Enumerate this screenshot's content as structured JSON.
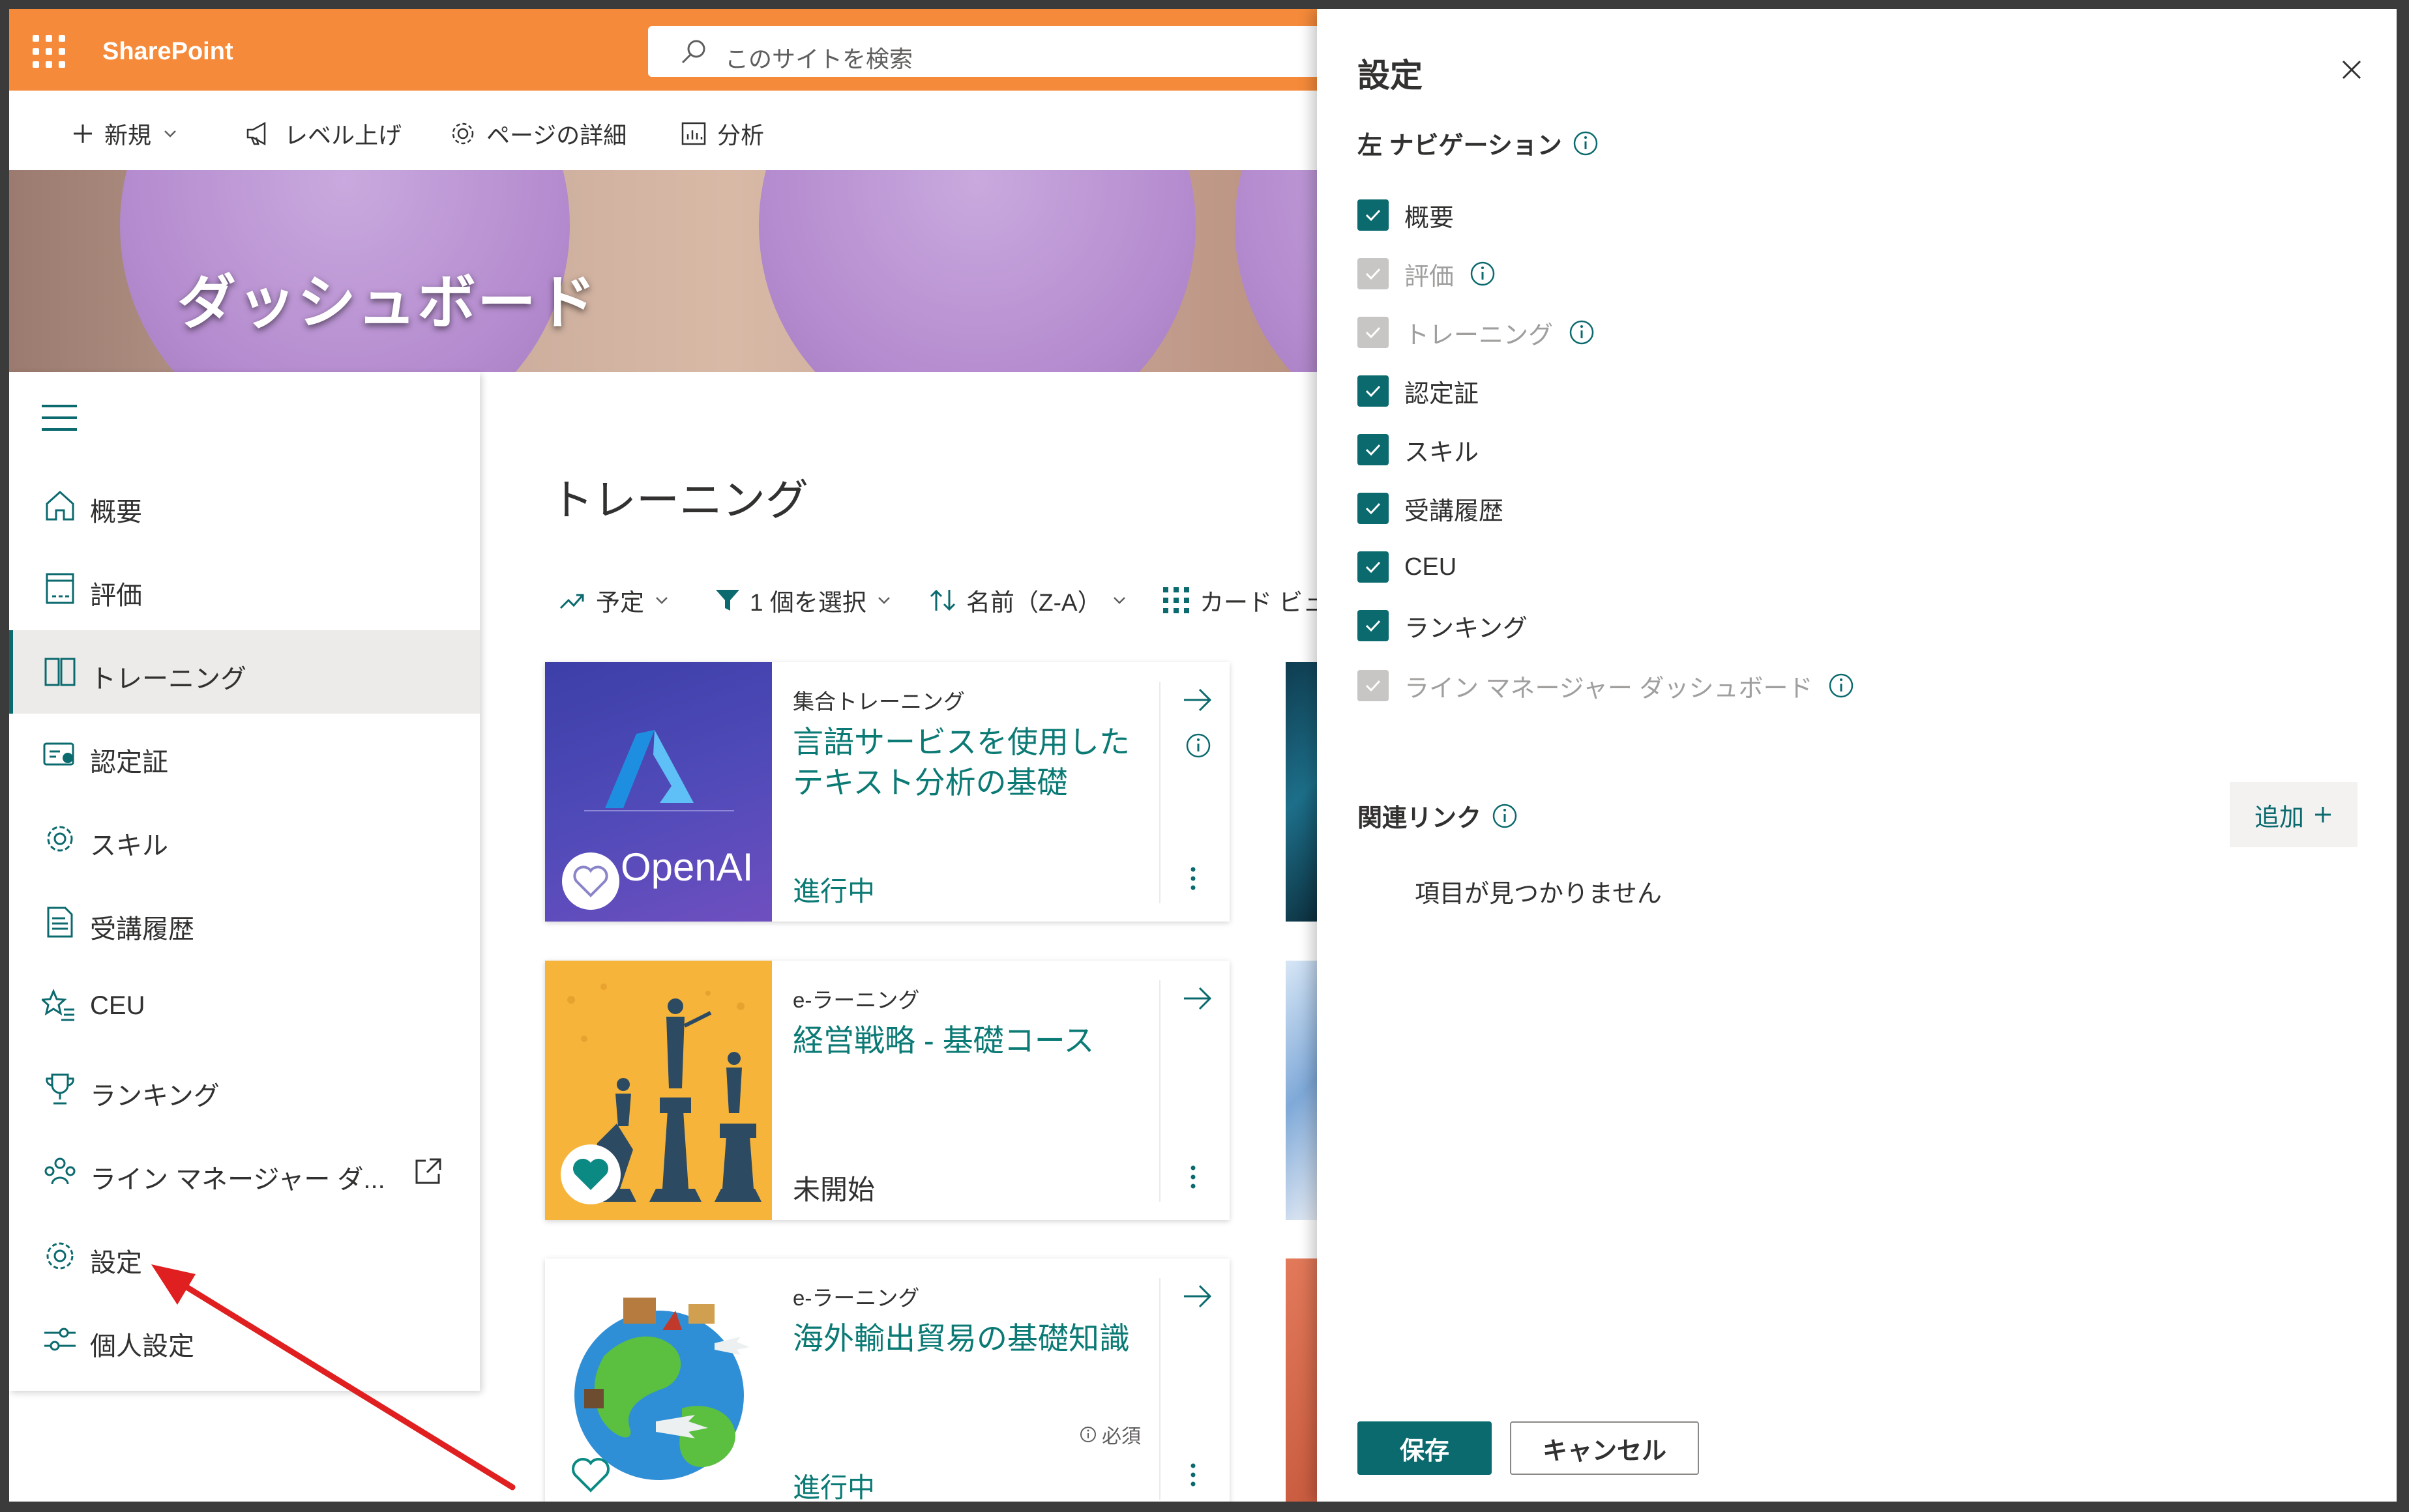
{
  "suite": {
    "app_name": "SharePoint",
    "search_placeholder": "このサイトを検索"
  },
  "commands": {
    "new": "新規",
    "level_up": "レベル上げ",
    "page_details": "ページの詳細",
    "analytics": "分析"
  },
  "hero": {
    "title": "ダッシュボード"
  },
  "nav": {
    "items": [
      {
        "label": "概要"
      },
      {
        "label": "評価"
      },
      {
        "label": "トレーニング",
        "active": true
      },
      {
        "label": "認定証"
      },
      {
        "label": "スキル"
      },
      {
        "label": "受講履歴"
      },
      {
        "label": "CEU"
      },
      {
        "label": "ランキング"
      },
      {
        "label": "ライン マネージャー ダ..."
      },
      {
        "label": "設定"
      },
      {
        "label": "個人設定"
      }
    ]
  },
  "main": {
    "title": "トレーニング",
    "filters": {
      "schedule": "予定",
      "select": "1 個を選択",
      "sort": "名前（Z-A）",
      "view": "カード ビュ"
    }
  },
  "cards": [
    {
      "type": "集合トレーニング",
      "title": "言語サービスを使用したテキスト分析の基礎",
      "status": "進行中",
      "thumb_text": "OpenAI"
    },
    {
      "type": "e-ラーニング",
      "title": "経営戦略 - 基礎コース",
      "status": "未開始"
    },
    {
      "type": "e-ラーニング",
      "title": "海外輸出貿易の基礎知識",
      "status": "進行中",
      "required": "必須"
    }
  ],
  "panel": {
    "title": "設定",
    "left_nav_section": "左 ナビゲーション",
    "nav_options": [
      {
        "label": "概要",
        "checked": true,
        "disabled": false,
        "info": false
      },
      {
        "label": "評価",
        "checked": true,
        "disabled": true,
        "info": true
      },
      {
        "label": "トレーニング",
        "checked": true,
        "disabled": true,
        "info": true
      },
      {
        "label": "認定証",
        "checked": true,
        "disabled": false,
        "info": false
      },
      {
        "label": "スキル",
        "checked": true,
        "disabled": false,
        "info": false
      },
      {
        "label": "受講履歴",
        "checked": true,
        "disabled": false,
        "info": false
      },
      {
        "label": "CEU",
        "checked": true,
        "disabled": false,
        "info": false
      },
      {
        "label": "ランキング",
        "checked": true,
        "disabled": false,
        "info": false
      },
      {
        "label": "ライン マネージャー ダッシュボード",
        "checked": true,
        "disabled": true,
        "info": true
      }
    ],
    "related_links_section": "関連リンク",
    "add_label": "追加",
    "empty_text": "項目が見つかりません",
    "save_label": "保存",
    "cancel_label": "キャンセル"
  },
  "colors": {
    "suite_bar": "#f58a3a",
    "accent": "#0b6a6e",
    "link": "#0b7a75",
    "annotation_arrow": "#e02020"
  }
}
